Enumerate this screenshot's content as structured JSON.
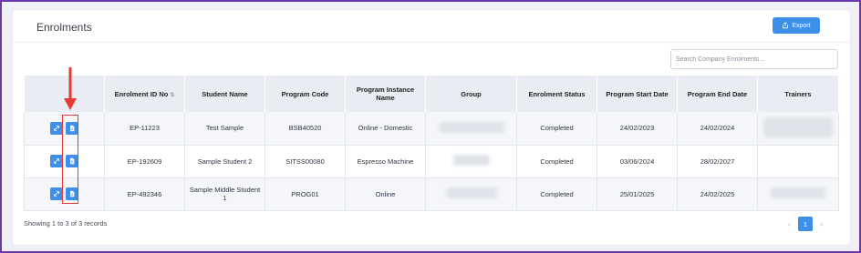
{
  "panel": {
    "title": "Enrolments",
    "export_label": "Export",
    "search_placeholder": "Search Company Enrolments..."
  },
  "table": {
    "headers": [
      "",
      "Enrolment ID No",
      "Student Name",
      "Program Code",
      "Program Instance Name",
      "Group",
      "Enrolment Status",
      "Program Start Date",
      "Program End Date",
      "Trainers"
    ],
    "rows": [
      {
        "id": "EP-11223",
        "student": "Test Sample",
        "code": "BSB40520",
        "instance": "Online - Domestic",
        "status": "Completed",
        "start": "24/02/2023",
        "end": "24/02/2024"
      },
      {
        "id": "EP-192609",
        "student": "Sample Student 2",
        "code": "SITSS00080",
        "instance": "Espresso Machine",
        "status": "Completed",
        "start": "03/06/2024",
        "end": "28/02/2027"
      },
      {
        "id": "EP-492346",
        "student": "Sample Middle Student 1",
        "code": "PROG01",
        "instance": "Online",
        "status": "Completed",
        "start": "25/01/2025",
        "end": "24/02/2025"
      }
    ]
  },
  "footer": {
    "records_text": "Showing 1 to 3 of 3 records",
    "current_page": "1",
    "prev_icon": "chevron-left-icon",
    "next_icon": "chevron-right-icon"
  },
  "colors": {
    "accent": "#3d8fe8",
    "annotation": "#e53935",
    "frame": "#6b3aa8"
  }
}
